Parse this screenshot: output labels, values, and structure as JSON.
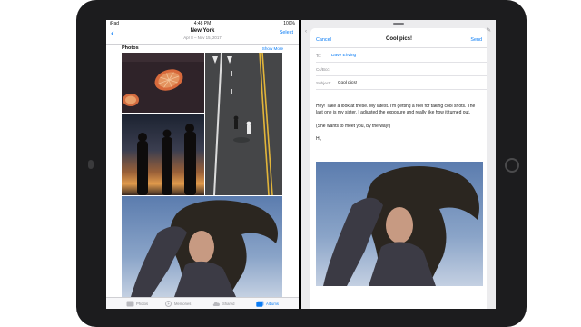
{
  "status_bar": {
    "carrier": "iPad",
    "time": "4:48 PM",
    "battery": "100%"
  },
  "photos_app": {
    "nav": {
      "back_icon": "chevron-left-icon",
      "title": "New York",
      "subtitle": "Apr 8 – Nov 15, 2017",
      "select_label": "Select"
    },
    "section": {
      "title": "Photos",
      "show_more": "Show More"
    },
    "thumbnails": [
      "grapefruit-halves",
      "skateboarders-on-road",
      "silhouettes-at-sunset",
      "woman-with-flowing-hair"
    ],
    "tabbar": [
      {
        "label": "Photos",
        "icon": "photos-icon",
        "active": false
      },
      {
        "label": "Memories",
        "icon": "memories-icon",
        "active": false
      },
      {
        "label": "Shared",
        "icon": "cloud-icon",
        "active": false
      },
      {
        "label": "Albums",
        "icon": "albums-icon",
        "active": true
      }
    ]
  },
  "mail_compose": {
    "cancel_label": "Cancel",
    "title": "Cool pics!",
    "send_label": "Send",
    "to_label": "To:",
    "to_value": "Dave Ehving",
    "ccbcc_label": "Cc/Bcc:",
    "subject_label": "Subject:",
    "subject_value": "Cool pics!",
    "body": [
      "Hey! Take a look at these. My latest. I'm getting a feel for taking cool shots. The last one is my sister. I adjusted the exposure and really like how it turned out.",
      "(She wants to meet you, by the way!)",
      "Hi,"
    ],
    "attachment": "woman-with-flowing-hair"
  },
  "colors": {
    "accent": "#0a7cf5",
    "device": "#1c1c1e"
  }
}
